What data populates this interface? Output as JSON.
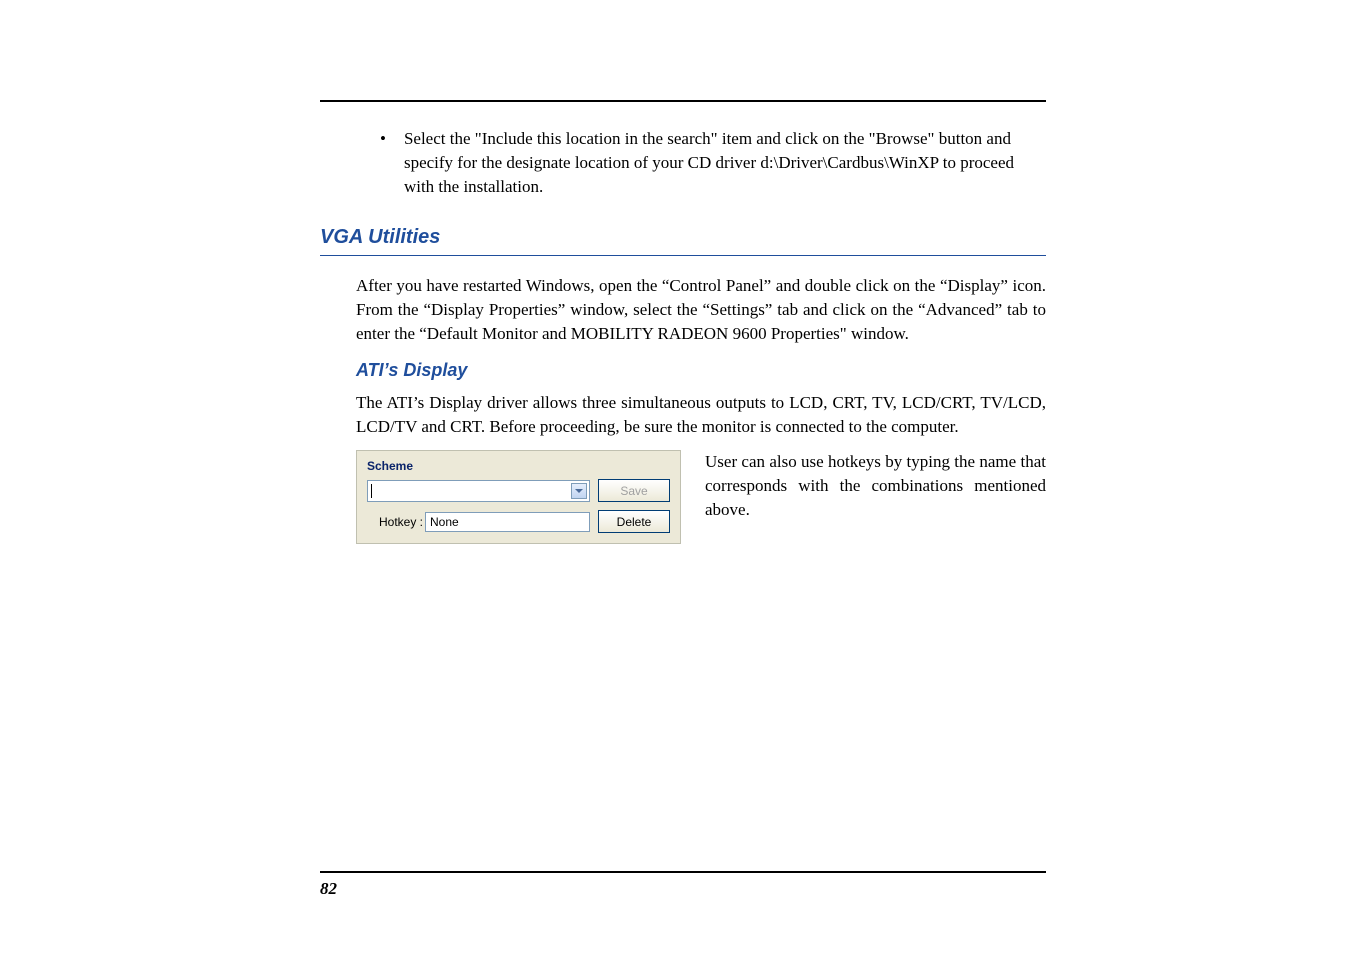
{
  "bullet": {
    "text": "Select the \"Include this location in the search\" item and click on the \"Browse\" button and specify for the designate location of your CD driver  d:\\Driver\\Cardbus\\WinXP to proceed with the installation."
  },
  "section1": {
    "heading": "VGA Utilities",
    "paragraph": "After you have restarted Windows, open the “Control Panel” and double click on the “Display” icon.  From the “Display Properties” window, select the “Settings” tab and click on the “Advanced” tab to enter the “Default Monitor and MOBILITY RADEON 9600 Properties\" window."
  },
  "section2": {
    "heading": "ATI’s Display",
    "paragraph": "The ATI’s Display driver allows three simultaneous outputs to LCD, CRT, TV, LCD/CRT, TV/LCD, LCD/TV and CRT.  Before proceeding, be sure the monitor is connected to the computer."
  },
  "scheme": {
    "title": "Scheme",
    "dropdown_value": "",
    "save_label": "Save",
    "hotkey_label": "Hotkey :",
    "hotkey_value": "None",
    "delete_label": "Delete"
  },
  "right_column": {
    "text": "User can also use hotkeys by typing the name that corresponds with the combinations mentioned above."
  },
  "footer": {
    "page_number": "82"
  }
}
